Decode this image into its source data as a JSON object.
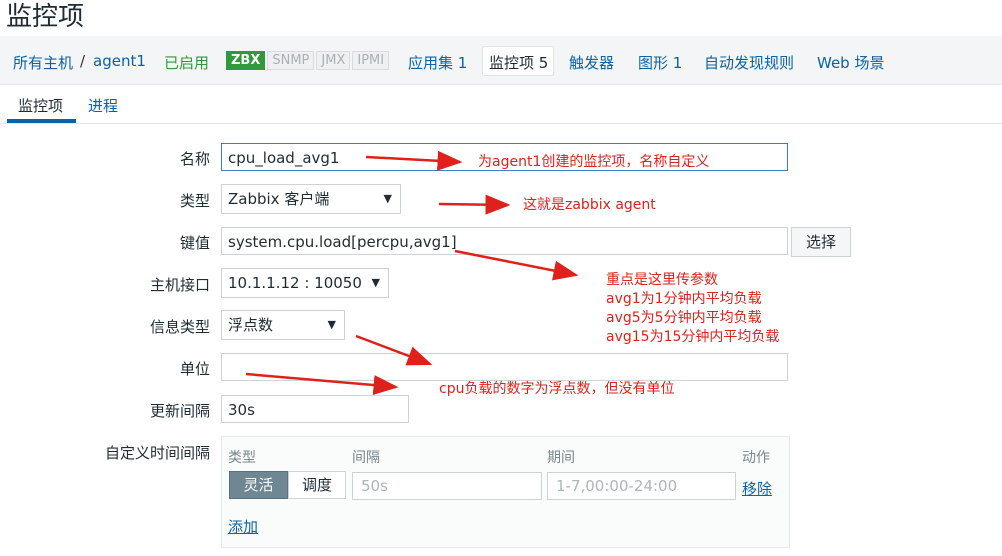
{
  "page": {
    "title": "监控项"
  },
  "nav": {
    "all_hosts": "所有主机",
    "sep": "/",
    "host": "agent1",
    "status": "已启用",
    "badges": [
      "ZBX",
      "SNMP",
      "JMX",
      "IPMI"
    ],
    "applications": "应用集 1",
    "items": "监控项 5",
    "triggers": "触发器",
    "graphs": "图形 1",
    "discovery": "自动发现规则",
    "web": "Web 场景"
  },
  "tabs": {
    "item": "监控项",
    "process": "进程"
  },
  "form": {
    "name_label": "名称",
    "name_value": "cpu_load_avg1",
    "type_label": "类型",
    "type_value": "Zabbix 客户端",
    "key_label": "键值",
    "key_value": "system.cpu.load[percpu,avg1]",
    "select_button": "选择",
    "interface_label": "主机接口",
    "interface_value": "10.1.1.12 : 10050",
    "info_type_label": "信息类型",
    "info_type_value": "浮点数",
    "unit_label": "单位",
    "unit_value": "",
    "interval_label": "更新间隔",
    "interval_value": "30s",
    "custom_label": "自定义时间间隔"
  },
  "custom": {
    "col_type": "类型",
    "col_interval": "间隔",
    "col_period": "期间",
    "col_action": "动作",
    "flexible": "灵活",
    "scheduling": "调度",
    "interval_placeholder": "50s",
    "period_placeholder": "1-7,00:00-24:00",
    "remove": "移除",
    "add": "添加"
  },
  "annotations": {
    "name_note": "为agent1创建的监控项，名称自定义",
    "type_note": "这就是zabbix agent",
    "key_note_1": "重点是这里传参数",
    "key_note_2": "avg1为1分钟内平均负载",
    "key_note_3": "avg5为5分钟内平均负载",
    "key_note_4": "avg15为15分钟内平均负载",
    "unit_note": "cpu负载的数字为浮点数，但没有单位"
  },
  "colors": {
    "link": "#0a62a8",
    "enabled": "#2f9a3b",
    "annotation": "#e0211b"
  }
}
